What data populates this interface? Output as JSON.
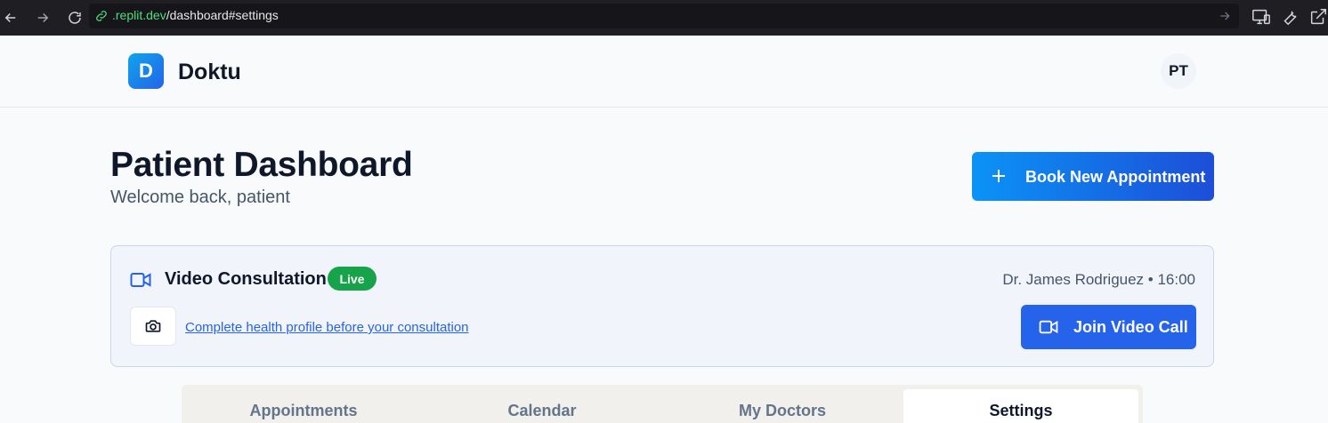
{
  "browser": {
    "url_host": ".replit.dev",
    "url_path": "/dashboard#settings",
    "icons": [
      "back-icon",
      "forward-icon",
      "reload-icon",
      "link-icon",
      "go-icon",
      "devices-icon",
      "wrench-icon",
      "open-external-icon"
    ]
  },
  "header": {
    "logo_letter": "D",
    "brand": "Doktu",
    "avatar_initials": "PT"
  },
  "page": {
    "title": "Patient Dashboard",
    "subtitle": "Welcome back, patient",
    "book_button": "Book New Appointment"
  },
  "consultation": {
    "title": "Video Consultation",
    "badge": "Live",
    "doctor_time": "Dr. James Rodriguez • 16:00",
    "profile_link": "Complete health profile before your consultation",
    "join_button": "Join Video Call"
  },
  "tabs": [
    {
      "label": "Appointments",
      "active": false
    },
    {
      "label": "Calendar",
      "active": false
    },
    {
      "label": "My Doctors",
      "active": false
    },
    {
      "label": "Settings",
      "active": true
    }
  ],
  "colors": {
    "primary": "#2563eb",
    "live": "#16a34a",
    "browser_bar": "#1f1f23"
  }
}
